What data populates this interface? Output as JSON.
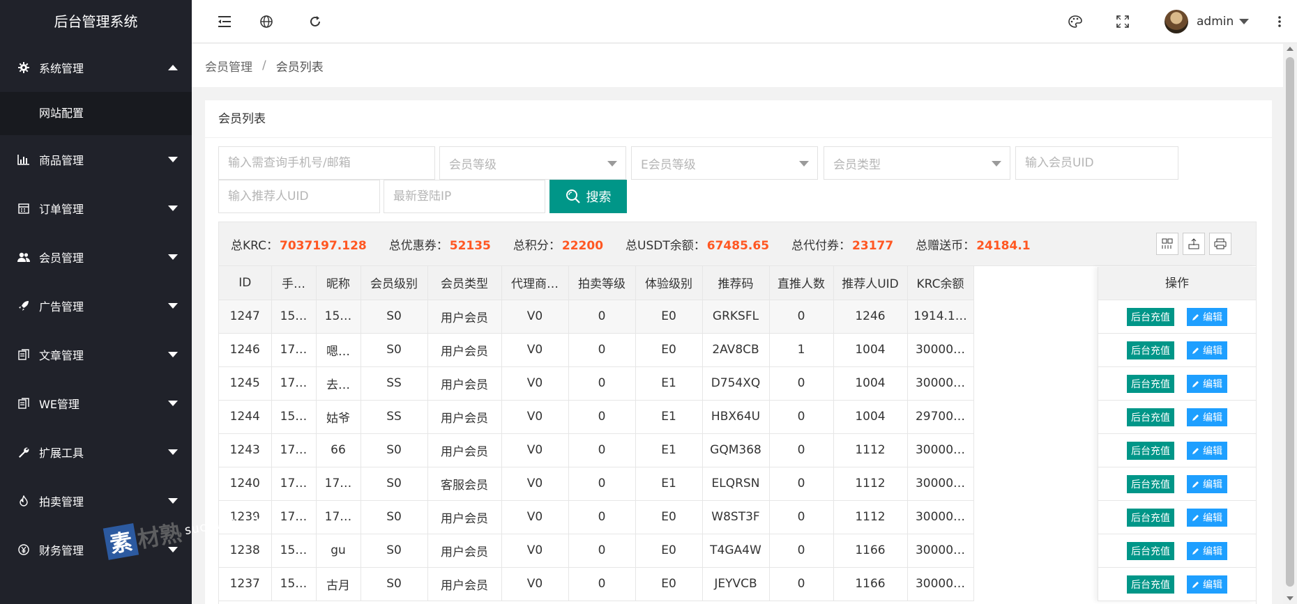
{
  "app": {
    "title": "后台管理系统"
  },
  "sidebar": {
    "items": [
      {
        "label": "系统管理",
        "icon": "gear-icon",
        "expanded": true
      },
      {
        "label": "商品管理",
        "icon": "chart-icon"
      },
      {
        "label": "订单管理",
        "icon": "calendar-icon"
      },
      {
        "label": "会员管理",
        "icon": "users-icon"
      },
      {
        "label": "广告管理",
        "icon": "rocket-icon"
      },
      {
        "label": "文章管理",
        "icon": "file-icon"
      },
      {
        "label": "WE管理",
        "icon": "file-icon"
      },
      {
        "label": "扩展工具",
        "icon": "wrench-icon"
      },
      {
        "label": "拍卖管理",
        "icon": "fire-icon"
      },
      {
        "label": "财务管理",
        "icon": "yen-icon"
      }
    ],
    "sub_item": "网站配置"
  },
  "header": {
    "username": "admin"
  },
  "breadcrumb": {
    "parent": "会员管理",
    "separator": "/",
    "current": "会员列表"
  },
  "card": {
    "title": "会员列表"
  },
  "filters": {
    "phone_placeholder": "输入需查询手机号/邮箱",
    "level": "会员等级",
    "e_level": "E会员等级",
    "type": "会员类型",
    "uid_placeholder": "输入会员UID",
    "ref_uid_placeholder": "输入推荐人UID",
    "ip_placeholder": "最新登陆IP",
    "search_label": "搜索"
  },
  "stats": [
    {
      "label": "总KRC：",
      "value": "7037197.128"
    },
    {
      "label": "总优惠券：",
      "value": "52135"
    },
    {
      "label": "总积分：",
      "value": "22200"
    },
    {
      "label": "总USDT余额：",
      "value": "67485.65"
    },
    {
      "label": "总代付券：",
      "value": "23177"
    },
    {
      "label": "总赠送币：",
      "value": "24184.1"
    }
  ],
  "table": {
    "columns": [
      "ID",
      "手…",
      "昵称",
      "会员级别",
      "会员类型",
      "代理商…",
      "拍卖等级",
      "体验级别",
      "推荐码",
      "直推人数",
      "推荐人UID",
      "KRC余额"
    ],
    "ops_header": "操作",
    "recharge_label": "后台充值",
    "edit_label": "编辑",
    "rows": [
      [
        "1247",
        "15…",
        "15…",
        "S0",
        "用户会员",
        "V0",
        "0",
        "E0",
        "GRKSFL",
        "0",
        "1246",
        "1914.1…"
      ],
      [
        "1246",
        "17…",
        "嗯…",
        "S0",
        "用户会员",
        "V0",
        "0",
        "E0",
        "2AV8CB",
        "1",
        "1004",
        "30000…"
      ],
      [
        "1245",
        "17…",
        "去…",
        "SS",
        "用户会员",
        "V0",
        "0",
        "E1",
        "D754XQ",
        "0",
        "1004",
        "30000…"
      ],
      [
        "1244",
        "15…",
        "姑爷",
        "SS",
        "用户会员",
        "V0",
        "0",
        "E1",
        "HBX64U",
        "0",
        "1004",
        "29700…"
      ],
      [
        "1243",
        "17…",
        "66",
        "S0",
        "用户会员",
        "V0",
        "0",
        "E1",
        "GQM368",
        "0",
        "1112",
        "30000…"
      ],
      [
        "1240",
        "17…",
        "17…",
        "S0",
        "客服会员",
        "V0",
        "0",
        "E1",
        "ELQRSN",
        "0",
        "1112",
        "30000…"
      ],
      [
        "1239",
        "17…",
        "17…",
        "S0",
        "用户会员",
        "V0",
        "0",
        "E0",
        "W8ST3F",
        "0",
        "1112",
        "30000…"
      ],
      [
        "1238",
        "15…",
        "gu",
        "S0",
        "用户会员",
        "V0",
        "0",
        "E0",
        "T4GA4W",
        "0",
        "1166",
        "30000…"
      ],
      [
        "1237",
        "15…",
        "古月",
        "S0",
        "用户会员",
        "V0",
        "0",
        "E0",
        "JEYVCB",
        "0",
        "1166",
        "30000…"
      ]
    ]
  },
  "watermark": {
    "badge": "素",
    "text": "材熟",
    "url": "sucaire.com"
  },
  "colors": {
    "sidebar": "#20222a",
    "primary": "#009688",
    "edit": "#1e9fff",
    "stat_value": "#ff5722"
  }
}
